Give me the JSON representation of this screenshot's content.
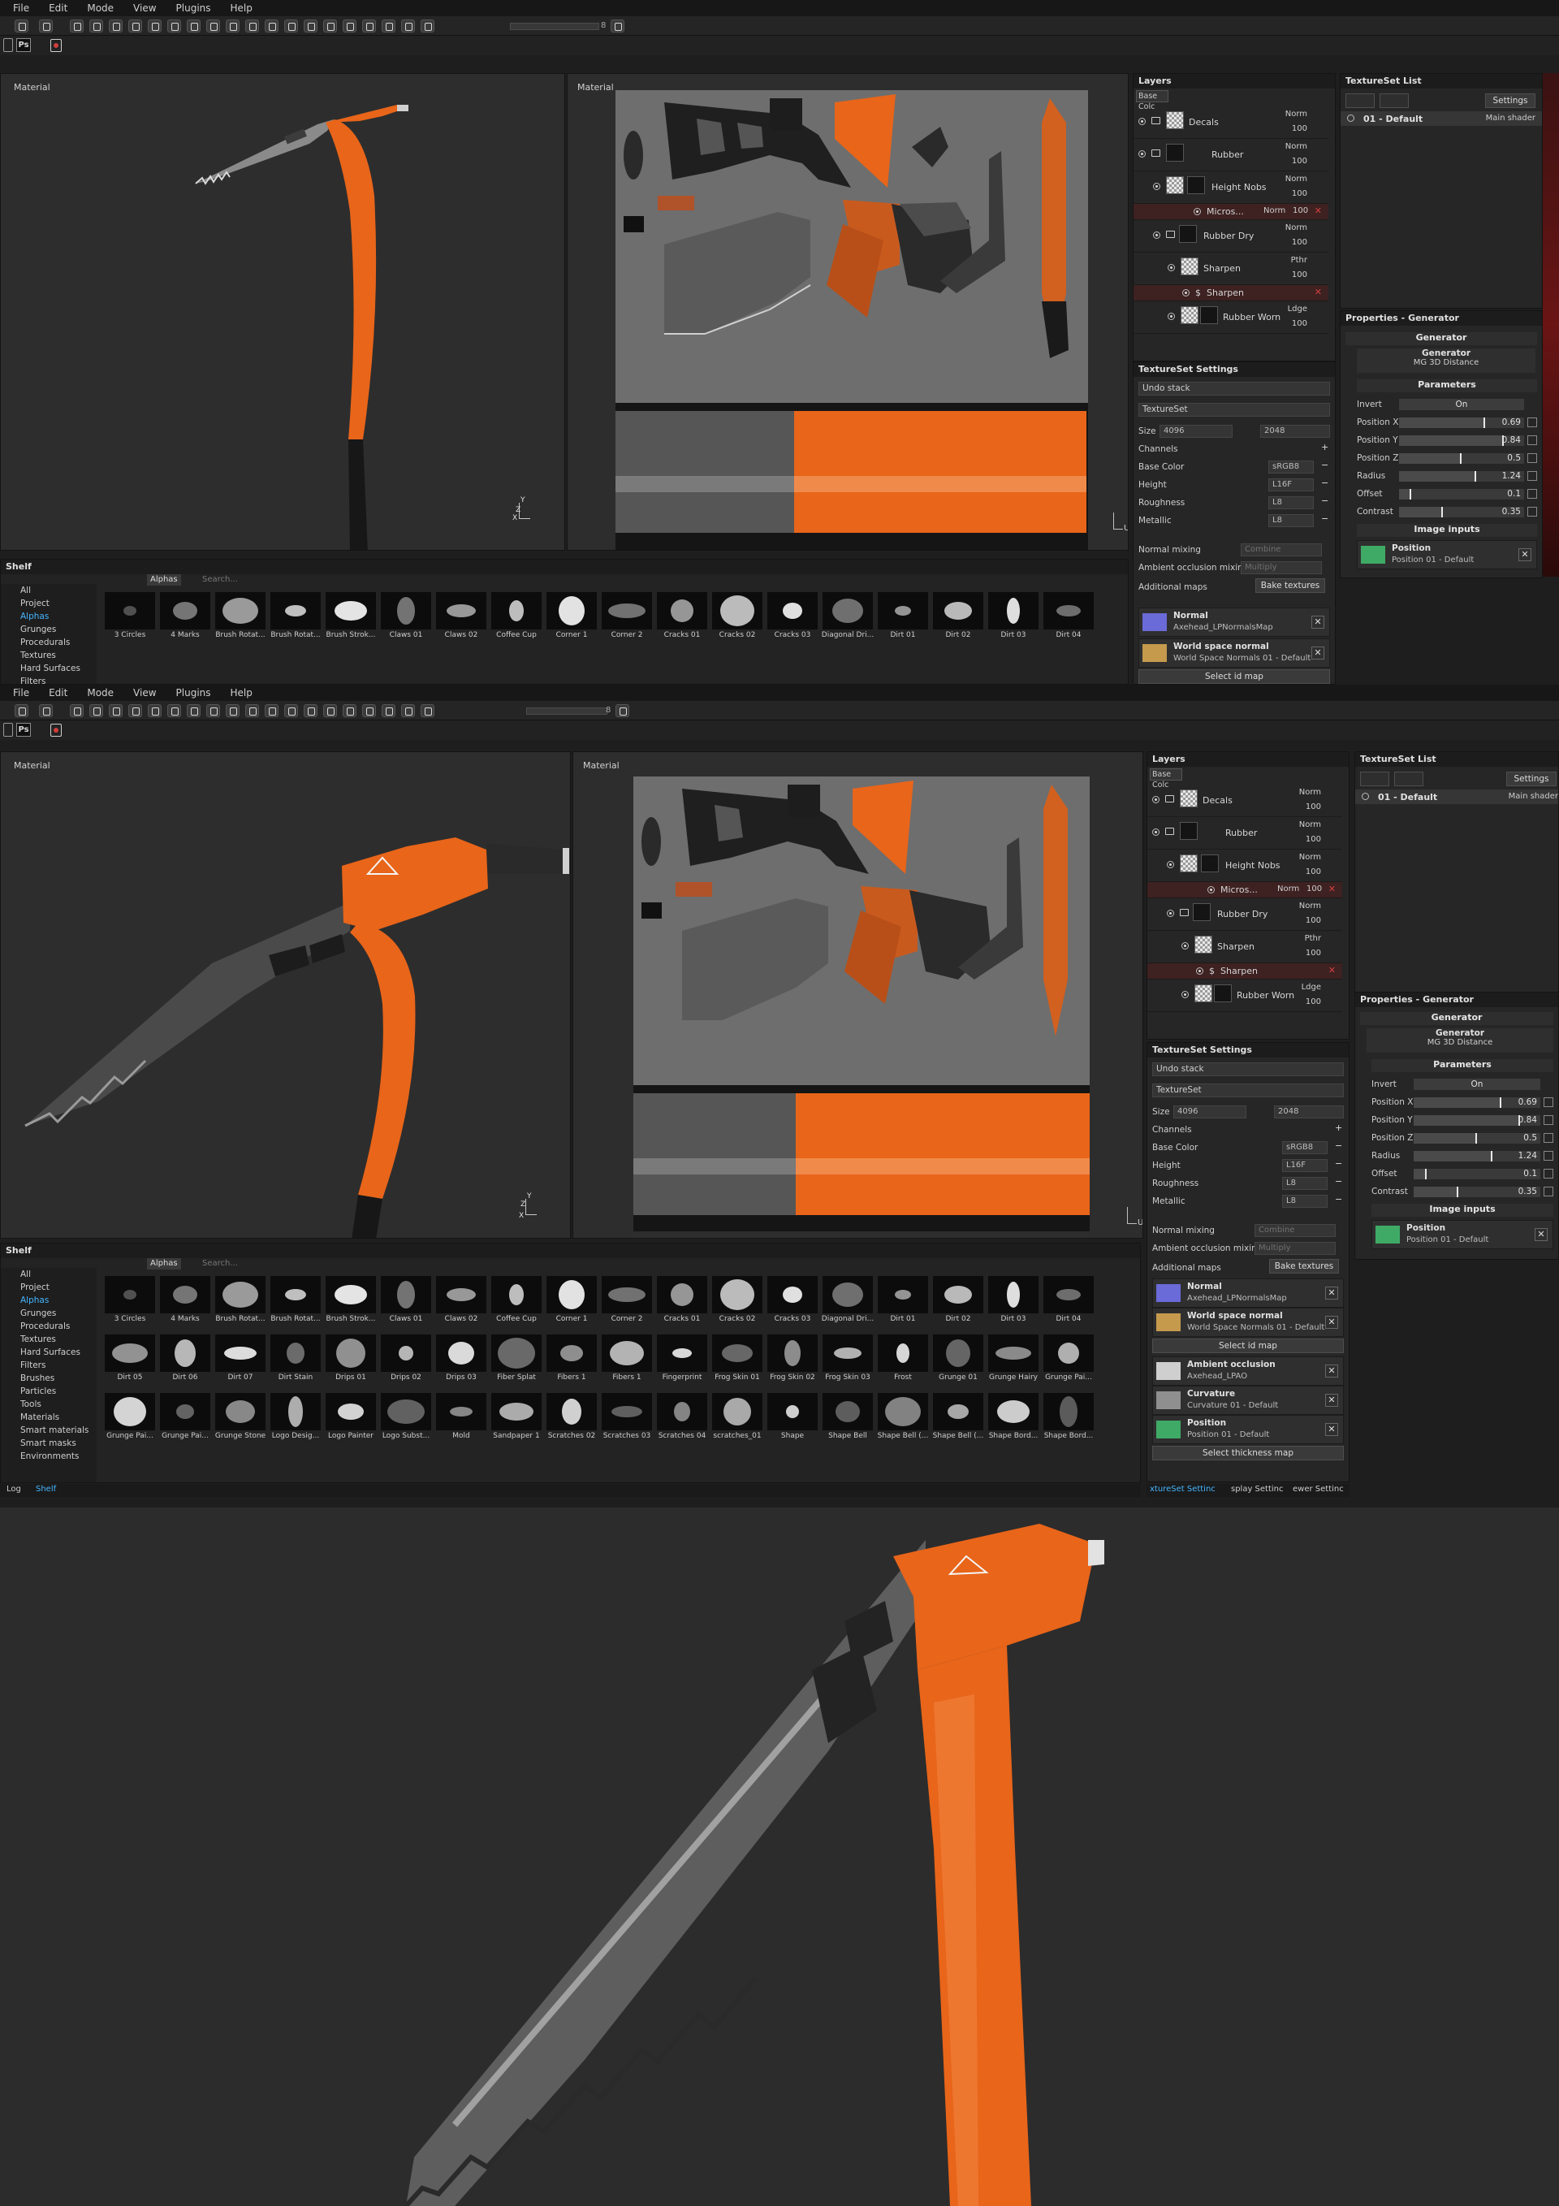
{
  "menu": [
    "File",
    "Edit",
    "Mode",
    "View",
    "Plugins",
    "Help"
  ],
  "toolbar": {
    "size_value": "8",
    "ps_label": "Ps"
  },
  "viewports": {
    "model_label": "Material",
    "texture_label": "Material",
    "axes": {
      "x": "X",
      "y": "Y",
      "z": "Z",
      "u": "U"
    }
  },
  "layers": {
    "title": "Layers",
    "channel_select": "Base Colc",
    "items": [
      {
        "name": "Decals",
        "blend": "Norm",
        "opacity": "100",
        "type": "folder"
      },
      {
        "name": "Rubber",
        "blend": "Norm",
        "opacity": "100",
        "type": "folder"
      },
      {
        "name": "Height Nobs",
        "blend": "Norm",
        "opacity": "100",
        "type": "fill"
      },
      {
        "name": "Micros...",
        "blend": "Norm",
        "opacity": "100",
        "type": "effect"
      },
      {
        "name": "Rubber Dry",
        "blend": "Norm",
        "opacity": "100",
        "type": "folder"
      },
      {
        "name": "Sharpen",
        "blend": "Pthr",
        "opacity": "100",
        "type": "fill"
      },
      {
        "name": "Sharpen",
        "blend": "",
        "opacity": "",
        "type": "effect"
      },
      {
        "name": "Rubber Worn",
        "blend": "Ldge",
        "opacity": "100",
        "type": "fill"
      }
    ]
  },
  "texture_set_settings": {
    "title": "TextureSet Settings",
    "undo_stack": "Undo stack",
    "texture_set": "TextureSet",
    "size_label": "Size",
    "size_value": "4096",
    "size_value2": "2048",
    "channels_label": "Channels",
    "channels": [
      {
        "name": "Base Color",
        "format": "sRGB8"
      },
      {
        "name": "Height",
        "format": "L16F"
      },
      {
        "name": "Roughness",
        "format": "L8"
      },
      {
        "name": "Metallic",
        "format": "L8"
      }
    ],
    "normal_mixing_label": "Normal mixing",
    "normal_mixing_value": "Combine",
    "ao_mixing_label": "Ambient occlusion mixing",
    "ao_mixing_value": "Multiply",
    "additional_maps_label": "Additional maps",
    "bake_button": "Bake textures",
    "maps": [
      {
        "title": "Normal",
        "sub": "Axehead_LPNormalsMap",
        "color": "#6a6ad8"
      },
      {
        "title": "World space normal",
        "sub": "World Space Normals 01 - Default",
        "color": "#c59a4d"
      },
      {
        "title": "Ambient occlusion",
        "sub": "Axehead_LPAO",
        "color": "#cfcfcf"
      },
      {
        "title": "Curvature",
        "sub": "Curvature 01 - Default",
        "color": "#8f8f8f"
      },
      {
        "title": "Position",
        "sub": "Position 01 - Default",
        "color": "#3faa66"
      }
    ],
    "select_id_map": "Select id map",
    "select_thickness_map": "Select thickness map"
  },
  "texture_set_list": {
    "title": "TextureSet List",
    "settings_button": "Settings",
    "item_name": "01 - Default",
    "item_shader": "Main shader"
  },
  "properties": {
    "title": "Properties - Generator",
    "section": "Generator",
    "generator_label": "Generator",
    "generator_value": "MG 3D Distance",
    "parameters_label": "Parameters",
    "invert_label": "Invert",
    "invert_value": "On",
    "params": [
      {
        "label": "Position X",
        "value": "0.69",
        "fill": 0.69
      },
      {
        "label": "Position Y",
        "value": "0.84",
        "fill": 0.84
      },
      {
        "label": "Position Z",
        "value": "0.5",
        "fill": 0.5
      },
      {
        "label": "Radius",
        "value": "1.24",
        "fill": 0.62
      },
      {
        "label": "Offset",
        "value": "0.1",
        "fill": 0.1
      },
      {
        "label": "Contrast",
        "value": "0.35",
        "fill": 0.35
      }
    ],
    "image_inputs_label": "Image inputs",
    "input_title": "Position",
    "input_sub": "Position 01 - Default"
  },
  "shelf": {
    "title": "Shelf",
    "tab": "Alphas",
    "search_placeholder": "Search...",
    "categories": [
      "All",
      "Project",
      "Alphas",
      "Grunges",
      "Procedurals",
      "Textures",
      "Hard Surfaces",
      "Filters",
      "Brushes",
      "Particles",
      "Tools",
      "Materials",
      "Smart materials",
      "Smart masks",
      "Environments"
    ],
    "active_category": "Alphas",
    "items": [
      "3 Circles",
      "4 Marks",
      "Brush Rotat...",
      "Brush Rotat...",
      "Brush Strok...",
      "Claws 01",
      "Claws 02",
      "Coffee Cup",
      "Corner 1",
      "Corner 2",
      "Cracks 01",
      "Cracks 02",
      "Cracks 03",
      "Diagonal Dri...",
      "Dirt 01",
      "Dirt 02",
      "Dirt 03",
      "Dirt 04",
      "Dirt 05",
      "Dirt 06",
      "Dirt 07",
      "Dirt Stain",
      "Drips 01",
      "Drips 02",
      "Drips 03",
      "Fiber Splat",
      "Fibers 1",
      "Fibers 1",
      "Fingerprint",
      "Frog Skin 01",
      "Frog Skin 02",
      "Frog Skin 03",
      "Frost",
      "Grunge 01",
      "Grunge Hairy",
      "Grunge Pai...",
      "Grunge Pai...",
      "Grunge Pai...",
      "Grunge Stone",
      "Logo Desig...",
      "Logo Painter",
      "Logo Subst...",
      "Mold",
      "Sandpaper 1",
      "Scratches 02",
      "Scratches 03",
      "Scratches 04",
      "scratches_01",
      "Shape",
      "Shape Bell",
      "Shape Bell (...",
      "Shape Bell (...",
      "Shape Bord...",
      "Shape Bord..."
    ]
  },
  "bottom_tabs": {
    "log": "Log",
    "shelf": "Shelf",
    "tss": "xtureSet Settinc",
    "display": "splay Settinc",
    "viewer": "ewer Settinc"
  },
  "colors": {
    "accent_blue": "#44b5ff",
    "orange": "#e8651a",
    "selection_red": "#3e2121",
    "close_red": "#d14040"
  }
}
